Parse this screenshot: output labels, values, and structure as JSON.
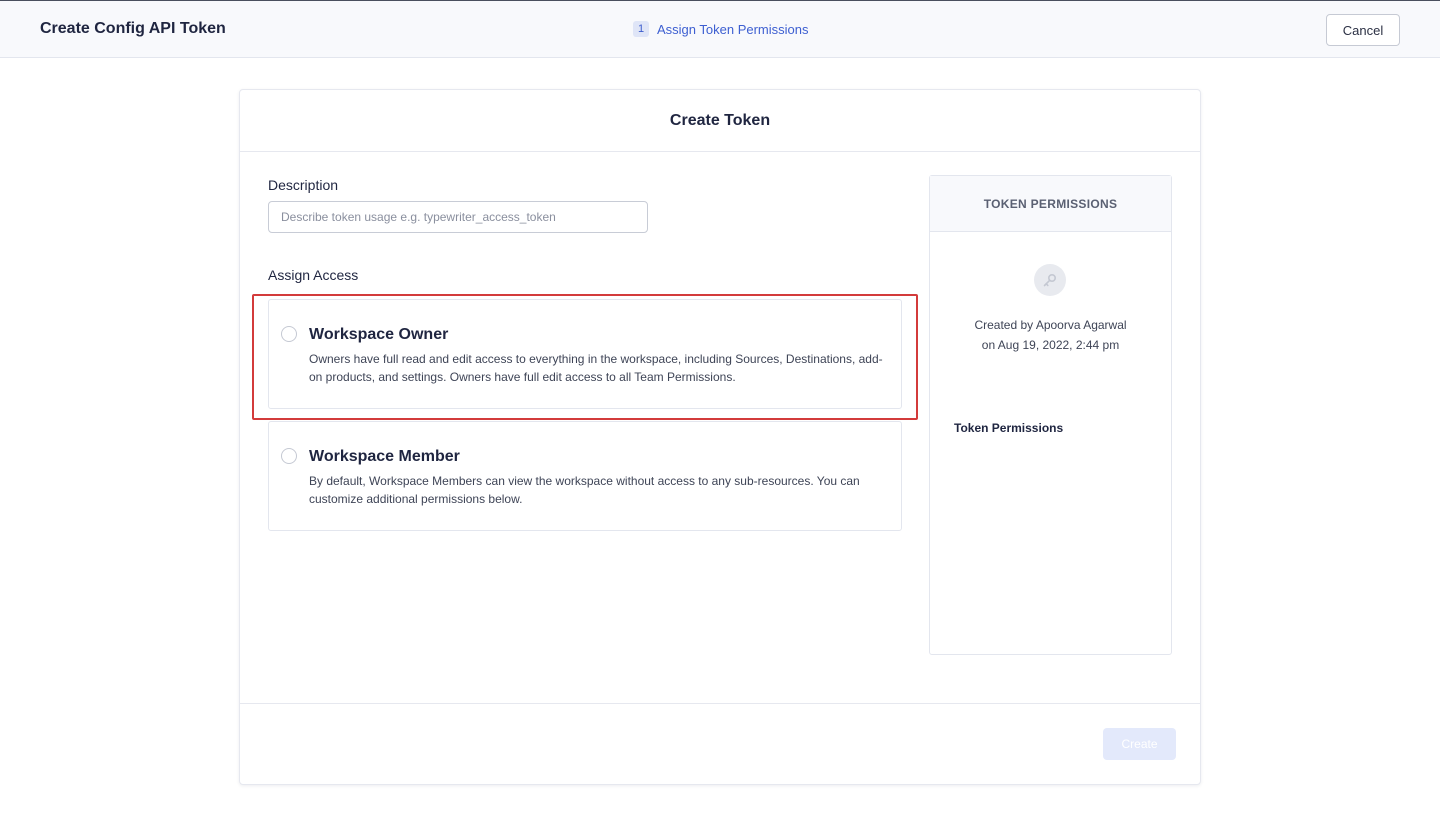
{
  "header": {
    "title": "Create Config API Token",
    "step_number": "1",
    "step_label": "Assign Token Permissions",
    "cancel_label": "Cancel"
  },
  "card": {
    "title": "Create Token",
    "description": {
      "label": "Description",
      "placeholder": "Describe token usage e.g. typewriter_access_token",
      "value": ""
    },
    "access": {
      "label": "Assign Access",
      "options": [
        {
          "title": "Workspace Owner",
          "description": "Owners have full read and edit access to everything in the workspace, including Sources, Destinations, add-on products, and settings. Owners have full edit access to all Team Permissions.",
          "selected": false
        },
        {
          "title": "Workspace Member",
          "description": "By default, Workspace Members can view the workspace without access to any sub-resources. You can customize additional permissions below.",
          "selected": false
        }
      ]
    },
    "create_label": "Create"
  },
  "permissions_panel": {
    "header": "TOKEN PERMISSIONS",
    "icon": "key-icon",
    "created_by": "Created by Apoorva Agarwal",
    "created_on": "on Aug 19, 2022, 2:44 pm",
    "section_label": "Token Permissions"
  },
  "colors": {
    "accent": "#3d5fd1",
    "highlight": "#d33b3b",
    "create_button_disabled": "#e3e9fb"
  }
}
